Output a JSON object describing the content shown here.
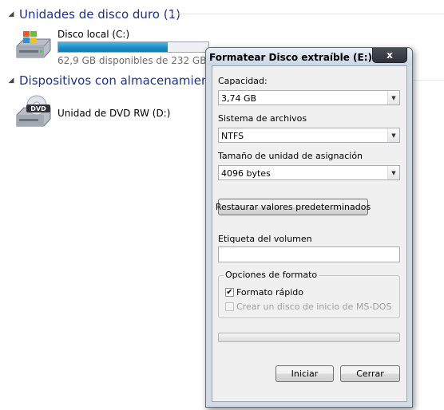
{
  "explorer": {
    "sections": [
      {
        "title": "Unidades de disco duro (1)"
      },
      {
        "title": "Dispositivos con almacenamiento e"
      }
    ],
    "drives": {
      "local": {
        "name": "Disco local (C:)",
        "free_text": "62,9 GB disponibles de 232 GB",
        "used_fraction": 0.73
      },
      "dvd": {
        "name": "Unidad de DVD RW (D:)",
        "icon_label": "DVD"
      }
    }
  },
  "dialog": {
    "title": "Formatear Disco extraíble (E:)",
    "close_glyph": "x",
    "capacity_label": "Capacidad:",
    "capacity_value": "3,74 GB",
    "filesystem_label": "Sistema de archivos",
    "filesystem_value": "NTFS",
    "allocation_label": "Tamaño de unidad de asignación",
    "allocation_value": "4096 bytes",
    "restore_button": "Restaurar valores predeterminados",
    "volume_label": "Etiqueta del volumen",
    "volume_value": "",
    "format_options_title": "Opciones de formato",
    "quick_format_label": "Formato rápido",
    "quick_format_checked": "✔",
    "msdos_label": "Crear un disco de inicio de MS-DOS",
    "start_button": "Iniciar",
    "close_button": "Cerrar"
  },
  "icons": [
    "hard-drive-icon",
    "dvd-drive-icon",
    "chevron-down-icon",
    "close-icon",
    "dropdown-arrow-icon"
  ]
}
